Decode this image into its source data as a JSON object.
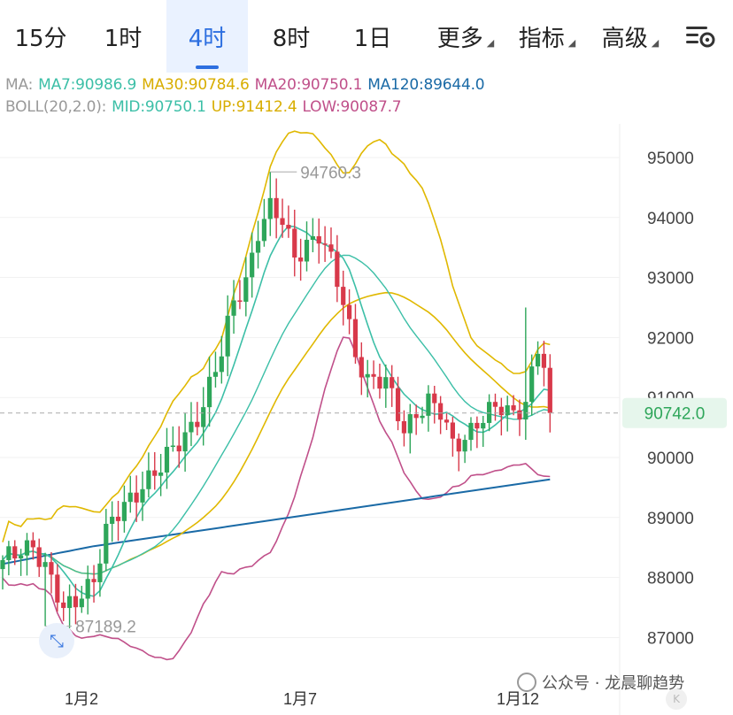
{
  "tabs": [
    {
      "label": "15分",
      "active": false
    },
    {
      "label": "1时",
      "active": false
    },
    {
      "label": "4时",
      "active": true
    },
    {
      "label": "8时",
      "active": false
    },
    {
      "label": "1日",
      "active": false
    },
    {
      "label": "更多",
      "active": false,
      "dropdown": false
    },
    {
      "label": "指标",
      "active": false,
      "dropdown": true
    },
    {
      "label": "高级",
      "active": false,
      "dropdown": true
    }
  ],
  "settings_icon": "chart-settings-icon",
  "legend": {
    "ma_prefix": "MA:",
    "ma7": "MA7:90986.9",
    "ma30": "MA30:90784.6",
    "ma20": "MA20:90750.1",
    "ma120": "MA120:89644.0",
    "boll_prefix": "BOLL(20,2.0):",
    "mid": "MID:90750.1",
    "up": "UP:91412.4",
    "low": "LOW:90087.7"
  },
  "colors": {
    "up": "#2ea65a",
    "down": "#d8394a",
    "ma7": "#3cbfa7",
    "ma30": "#e0b800",
    "ma20": "#c0508a",
    "ma120": "#1a6aa6",
    "accent": "#2d6fe0"
  },
  "chart_data": {
    "type": "candlestick",
    "y_ticks": [
      "95000",
      "94000",
      "93000",
      "92000",
      "91000",
      "90000",
      "89000",
      "88000",
      "87000"
    ],
    "y_tick_values": [
      95000,
      94000,
      93000,
      92000,
      91000,
      90000,
      89000,
      88000,
      87000
    ],
    "x_labels": [
      "1月2",
      "1月7",
      "1月12"
    ],
    "current_price": "90742.0",
    "current_price_value": 90742.0,
    "high_label": "94760.3",
    "high_value": 94760.3,
    "low_label": "87189.2",
    "low_value": 87189.2,
    "series_names": [
      "MA7",
      "MA30",
      "MA20",
      "MA120"
    ]
  },
  "watermark": "公众号 · 龙晨聊趋势",
  "expand_icon": "expand-arrows-icon"
}
